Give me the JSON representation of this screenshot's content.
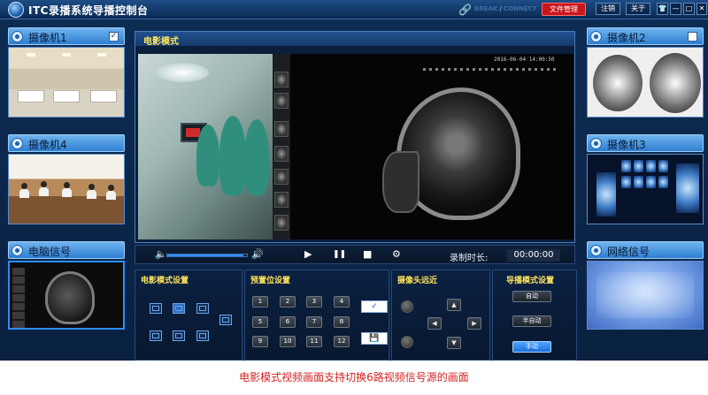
{
  "app": {
    "title": "ITC录播系统导播控制台",
    "status_left": "BREAK",
    "status_sep": "/",
    "status_right": "CONNECT",
    "file_manage": "文件管理",
    "logout": "注销",
    "about": "关于",
    "shirt_glyph": "👕",
    "minimize_glyph": "—",
    "maximize_glyph": "□",
    "close_glyph": "✕"
  },
  "cameras": {
    "cam1": {
      "label": "摄像机1",
      "checked": "✓"
    },
    "cam4": {
      "label": "摄像机4"
    },
    "pc": {
      "label": "电脑信号"
    },
    "cam2": {
      "label": "摄像机2",
      "checked": ""
    },
    "cam3": {
      "label": "摄像机3"
    },
    "net": {
      "label": "网络信号"
    }
  },
  "video": {
    "mode_title": "电影模式",
    "timestamp": "2016-06-04 14:00:50"
  },
  "playback": {
    "volume": 0.95,
    "record_label": "录制时长:",
    "record_time": "00:00:00",
    "icons": {
      "volume_low": "🔈",
      "volume_high": "🔊",
      "play": "▶",
      "pause": "❚❚",
      "stop": "■",
      "settings": "⚙"
    }
  },
  "controls": {
    "movie_mode_title": "电影模式设置",
    "preset_title": "预置位设置",
    "presets": [
      "1",
      "2",
      "3",
      "4",
      "5",
      "6",
      "7",
      "8",
      "9",
      "10",
      "11",
      "12"
    ],
    "confirm_glyph": "✓",
    "save_glyph": "💾",
    "camera_zoom_title": "摄像头远近",
    "arrows": {
      "up": "▲",
      "down": "▼",
      "left": "◀",
      "right": "▶"
    },
    "director_title": "导播模式设置",
    "modes": [
      {
        "label": "自动",
        "active": false
      },
      {
        "label": "半自动",
        "active": false
      },
      {
        "label": "手动",
        "active": true
      }
    ]
  },
  "caption": "电影模式视频画面支持切换6路视频信号源的画面",
  "colors": {
    "accent": "#2f8ef6",
    "title_yellow": "#ffe45c",
    "file_button": "#c8161d",
    "caption_red": "#d32222"
  }
}
